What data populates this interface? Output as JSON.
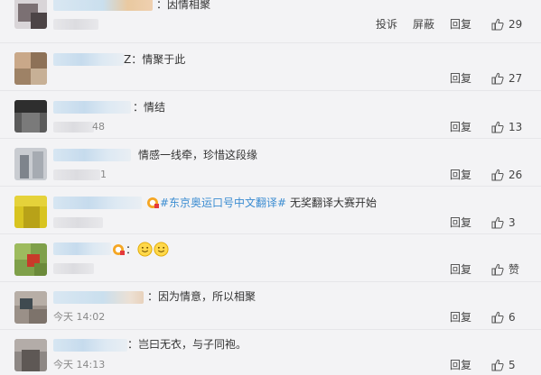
{
  "comments": [
    {
      "text": "：因情相聚",
      "time": "",
      "actions": [
        "投诉",
        "屏蔽",
        "回复"
      ],
      "likes": "29"
    },
    {
      "text": "Z：情聚于此",
      "time": "",
      "actions": [
        "回复"
      ],
      "likes": "27"
    },
    {
      "text": "：情结",
      "time": "48",
      "actions": [
        "回复"
      ],
      "likes": "13"
    },
    {
      "text": "情感一线牵，珍惜这段缘",
      "time": "1",
      "actions": [
        "回复"
      ],
      "likes": "26"
    },
    {
      "topic": "#东京奥运口号中文翻译#",
      "text": " 无奖翻译大赛开始",
      "time": "",
      "actions": [
        "回复"
      ],
      "likes": "3"
    },
    {
      "text": "",
      "time": "",
      "actions": [
        "回复"
      ],
      "likes": "赞"
    },
    {
      "text": "：因为情意，所以相聚",
      "time": "今天 14:02",
      "actions": [
        "回复"
      ],
      "likes": "6"
    },
    {
      "text": "：岂曰无衣，与子同袍。",
      "time": "今天 14:13",
      "actions": [
        "回复"
      ],
      "likes": "5"
    }
  ],
  "colors": {
    "background": "#f3f3f5",
    "topic": "#3b8cd1",
    "text": "#333333",
    "muted": "#888888"
  },
  "icons": {
    "like": "thumb-up-icon",
    "emoji": "smiley-face-icon",
    "badge": "vip-badge-icon"
  }
}
